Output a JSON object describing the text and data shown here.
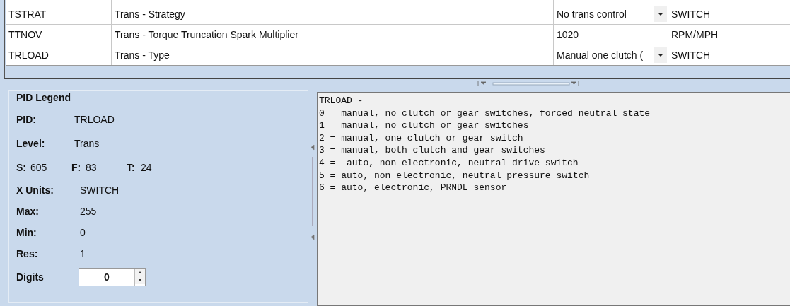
{
  "table": {
    "rows": [
      {
        "pid": "TSTRAT",
        "description": "Trans - Strategy",
        "value": {
          "kind": "dropdown",
          "text": "No trans control"
        },
        "units": "SWITCH"
      },
      {
        "pid": "TTNOV",
        "description": "Trans - Torque Truncation Spark Multiplier",
        "value": {
          "kind": "text",
          "text": "1020"
        },
        "units": "RPM/MPH"
      },
      {
        "pid": "TRLOAD",
        "description": "Trans - Type",
        "value": {
          "kind": "dropdown",
          "text": "Manual one clutch ("
        },
        "units": "SWITCH"
      }
    ]
  },
  "legend": {
    "title": "PID Legend",
    "pid": {
      "label": "PID:",
      "value": "TRLOAD"
    },
    "level": {
      "label": "Level:",
      "value": "Trans"
    },
    "sft": [
      {
        "label": "S:",
        "value": "605"
      },
      {
        "label": "F:",
        "value": "83"
      },
      {
        "label": "T:",
        "value": "24"
      }
    ],
    "fields": [
      {
        "label": "X Units:",
        "value": "SWITCH"
      },
      {
        "label": "Max:",
        "value": "255"
      },
      {
        "label": "Min:",
        "value": "0"
      },
      {
        "label": "Res:",
        "value": "1"
      }
    ],
    "digits": {
      "label": "Digits",
      "value": "0"
    }
  },
  "description_lines": [
    "TRLOAD -",
    "0 = manual, no clutch or gear switches, forced neutral state",
    "1 = manual, no clutch or gear switches",
    "2 = manual, one clutch or gear switch",
    "3 = manual, both clutch and gear switches",
    "4 =  auto, non electronic, neutral drive switch",
    "5 = auto, non electronic, neutral pressure switch",
    "6 = auto, electronic, PRNDL sensor"
  ]
}
